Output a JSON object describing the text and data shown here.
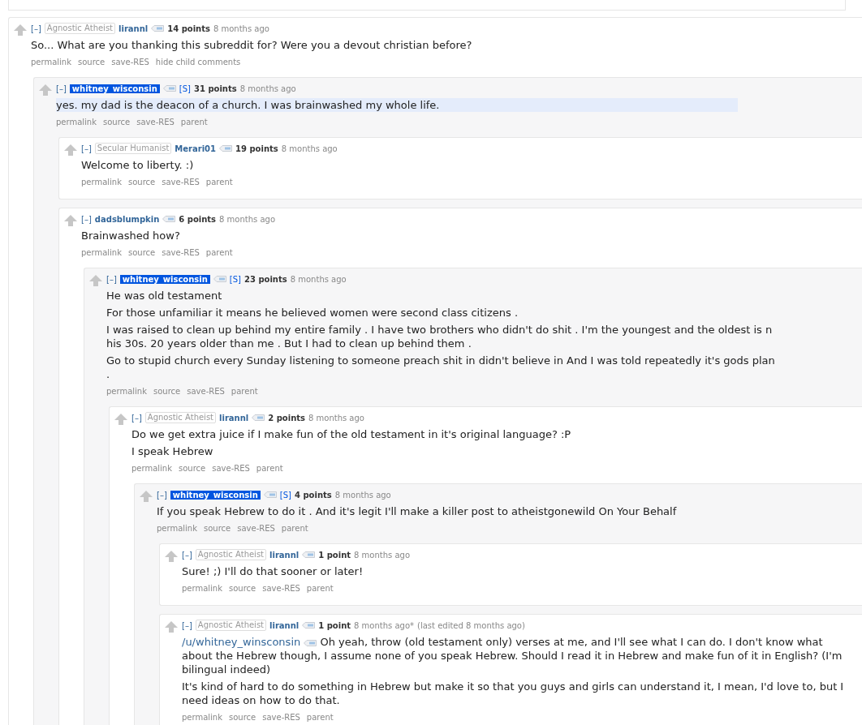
{
  "comments": [
    {
      "collapse_label": "[–]",
      "flair": "Agnostic Atheist",
      "author": "lirannl",
      "submitter": false,
      "points": "14 points",
      "time": "8 months ago",
      "paragraphs": [
        {
          "kind": "text",
          "text": "So... What are you thanking this subreddit for? Were you a devout christian before?",
          "highlighted": false
        }
      ],
      "links": [
        "permalink",
        "source",
        "save-RES",
        "hide child comments"
      ],
      "children": [
        {
          "collapse_label": "[–]",
          "author": "whitney_wisconsin",
          "submitter": true,
          "submitter_label": "[S]",
          "points": "31 points",
          "time": "8 months ago",
          "paragraphs": [
            {
              "kind": "text",
              "text": "yes. my dad is the deacon of a church. I was brainwashed my whole life.",
              "highlighted": true
            }
          ],
          "links": [
            "permalink",
            "source",
            "save-RES",
            "parent"
          ],
          "children": [
            {
              "collapse_label": "[–]",
              "flair": "Secular Humanist",
              "author": "Merari01",
              "submitter": false,
              "points": "19 points",
              "time": "8 months ago",
              "paragraphs": [
                {
                  "kind": "text",
                  "text": "Welcome to liberty. :)",
                  "highlighted": false
                }
              ],
              "links": [
                "permalink",
                "source",
                "save-RES",
                "parent"
              ]
            },
            {
              "collapse_label": "[–]",
              "author": "dadsblumpkin",
              "submitter": false,
              "points": "6 points",
              "time": "8 months ago",
              "paragraphs": [
                {
                  "kind": "text",
                  "text": "Brainwashed how?",
                  "highlighted": false
                }
              ],
              "links": [
                "permalink",
                "source",
                "save-RES",
                "parent"
              ],
              "children": [
                {
                  "collapse_label": "[–]",
                  "author": "whitney_wisconsin",
                  "submitter": true,
                  "submitter_label": "[S]",
                  "points": "23 points",
                  "time": "8 months ago",
                  "paragraphs": [
                    {
                      "kind": "text",
                      "text": "He was old testament",
                      "highlighted": false
                    },
                    {
                      "kind": "text",
                      "text": "For those unfamiliar it means he believed women were second class citizens .",
                      "highlighted": false
                    },
                    {
                      "kind": "text",
                      "text": "I was raised to clean up behind my entire family . I have two brothers who didn't do shit . I'm the youngest and the oldest is n his 30s. 20 years older than me . But I had to clean up behind them .",
                      "highlighted": false
                    },
                    {
                      "kind": "text",
                      "text": "Go to stupid church every Sunday listening to someone preach shit in didn't believe in And I was told repeatedly it's gods plan .",
                      "highlighted": false
                    }
                  ],
                  "links": [
                    "permalink",
                    "source",
                    "save-RES",
                    "parent"
                  ],
                  "children": [
                    {
                      "collapse_label": "[–]",
                      "flair": "Agnostic Atheist",
                      "author": "lirannl",
                      "submitter": false,
                      "points": "2 points",
                      "time": "8 months ago",
                      "paragraphs": [
                        {
                          "kind": "text",
                          "text": "Do we get extra juice if I make fun of the old testament in it's original language? :P",
                          "highlighted": false
                        },
                        {
                          "kind": "text",
                          "text": "I speak Hebrew",
                          "highlighted": false
                        }
                      ],
                      "links": [
                        "permalink",
                        "source",
                        "save-RES",
                        "parent"
                      ],
                      "children": [
                        {
                          "collapse_label": "[–]",
                          "author": "whitney_wisconsin",
                          "submitter": true,
                          "submitter_label": "[S]",
                          "points": "4 points",
                          "time": "8 months ago",
                          "paragraphs": [
                            {
                              "kind": "text",
                              "text": "If you speak Hebrew to do it . And it's legit I'll make a killer post to atheistgonewild On Your Behalf",
                              "highlighted": false
                            }
                          ],
                          "links": [
                            "permalink",
                            "source",
                            "save-RES",
                            "parent"
                          ],
                          "children": [
                            {
                              "collapse_label": "[–]",
                              "flair": "Agnostic Atheist",
                              "author": "lirannl",
                              "submitter": false,
                              "points": "1 point",
                              "time": "8 months ago",
                              "paragraphs": [
                                {
                                  "kind": "text",
                                  "text": "Sure! ;) I'll do that sooner or later!",
                                  "highlighted": false
                                }
                              ],
                              "links": [
                                "permalink",
                                "source",
                                "save-RES",
                                "parent"
                              ]
                            },
                            {
                              "collapse_label": "[–]",
                              "flair": "Agnostic Atheist",
                              "author": "lirannl",
                              "submitter": false,
                              "points": "1 point",
                              "time": "8 months ago*",
                              "edited": "(last edited 8 months ago)",
                              "paragraphs": [
                                {
                                  "kind": "mention",
                                  "mention": "/u/whitney_winsconsin",
                                  "text": "Oh yeah, throw (old testament only) verses at me, and I'll see what I can do. I don't know what about the Hebrew though, I assume none of you speak Hebrew. Should I read it in Hebrew and make fun of it in English? (I'm bilingual indeed)",
                                  "highlighted": false
                                },
                                {
                                  "kind": "text",
                                  "text": "It's kind of hard to do something in Hebrew but make it so that you guys and girls can understand it, I mean, I'd love to, but I need ideas on how to do that.",
                                  "highlighted": false
                                }
                              ],
                              "links": [
                                "permalink",
                                "source",
                                "save-RES",
                                "parent"
                              ]
                            }
                          ]
                        }
                      ]
                    }
                  ]
                }
              ]
            }
          ]
        }
      ]
    }
  ]
}
